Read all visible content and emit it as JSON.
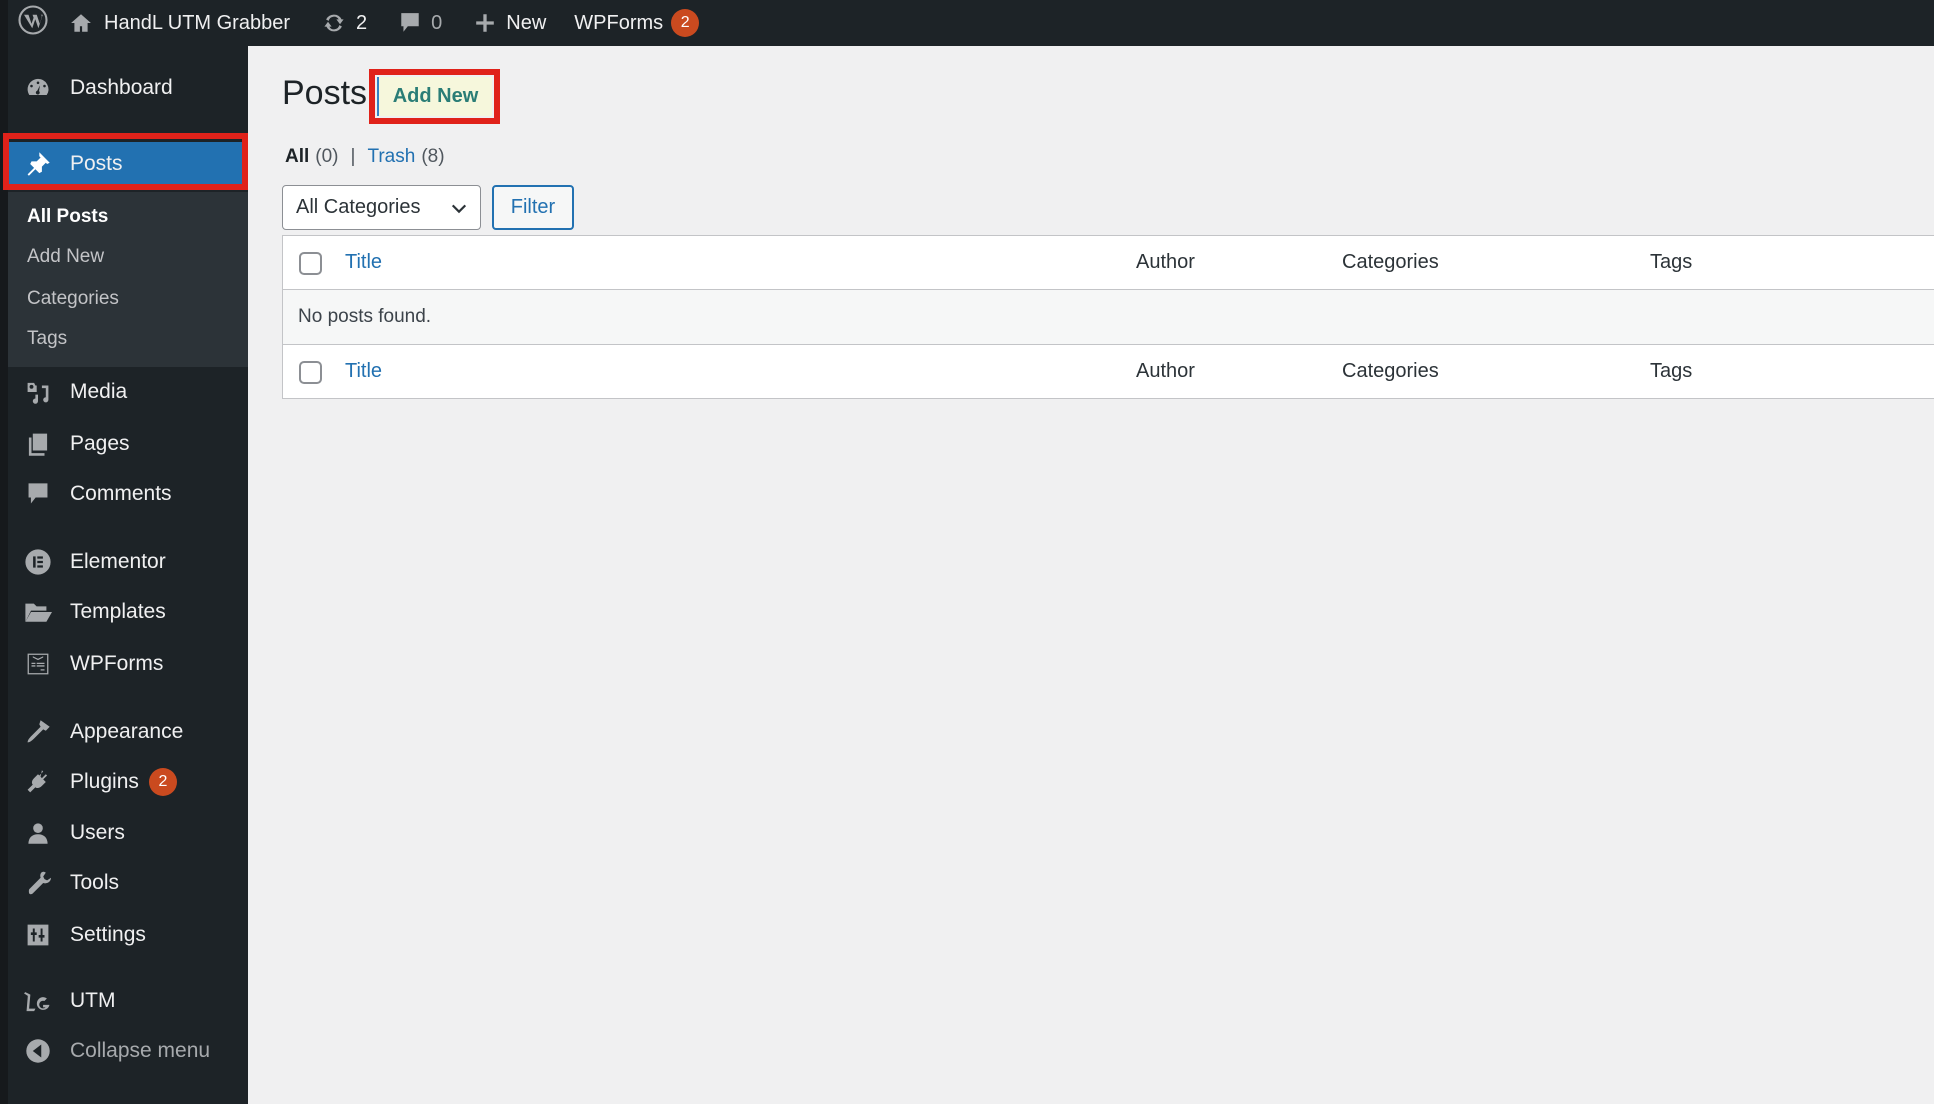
{
  "admin_bar": {
    "site_name": "HandL UTM Grabber",
    "updates_count": "2",
    "comments_count": "0",
    "new_label": "New",
    "wpforms_label": "WPForms",
    "wpforms_badge": "2"
  },
  "sidebar": {
    "items": [
      {
        "label": "Dashboard",
        "icon": "dashboard-icon"
      },
      {
        "label": "Posts",
        "icon": "pushpin-icon",
        "current": true
      },
      {
        "label": "Media",
        "icon": "media-icon"
      },
      {
        "label": "Pages",
        "icon": "pages-icon"
      },
      {
        "label": "Comments",
        "icon": "comments-icon"
      },
      {
        "label": "Elementor",
        "icon": "elementor-icon"
      },
      {
        "label": "Templates",
        "icon": "folder-icon"
      },
      {
        "label": "WPForms",
        "icon": "wpforms-icon"
      },
      {
        "label": "Appearance",
        "icon": "paintbrush-icon"
      },
      {
        "label": "Plugins",
        "icon": "plugin-icon",
        "badge": "2"
      },
      {
        "label": "Users",
        "icon": "user-icon"
      },
      {
        "label": "Tools",
        "icon": "wrench-icon"
      },
      {
        "label": "Settings",
        "icon": "sliders-icon"
      },
      {
        "label": "UTM",
        "icon": "utm-icon"
      },
      {
        "label": "Collapse menu",
        "icon": "collapse-icon"
      }
    ],
    "submenu": [
      {
        "label": "All Posts",
        "current": true
      },
      {
        "label": "Add New"
      },
      {
        "label": "Categories"
      },
      {
        "label": "Tags"
      }
    ]
  },
  "main": {
    "page_title": "Posts",
    "add_new_label": "Add New",
    "views": {
      "all_label": "All",
      "all_count": "(0)",
      "separator": "|",
      "trash_label": "Trash",
      "trash_count": "(8)"
    },
    "category_filter": {
      "selected": "All Categories"
    },
    "filter_label": "Filter",
    "table": {
      "columns": [
        "Title",
        "Author",
        "Categories",
        "Tags"
      ],
      "empty_message": "No posts found."
    }
  },
  "colors": {
    "accent": "#2271b1",
    "admin_bar": "#1d2327",
    "highlight_box": "#e0221a",
    "badge": "#ca4a1f"
  }
}
